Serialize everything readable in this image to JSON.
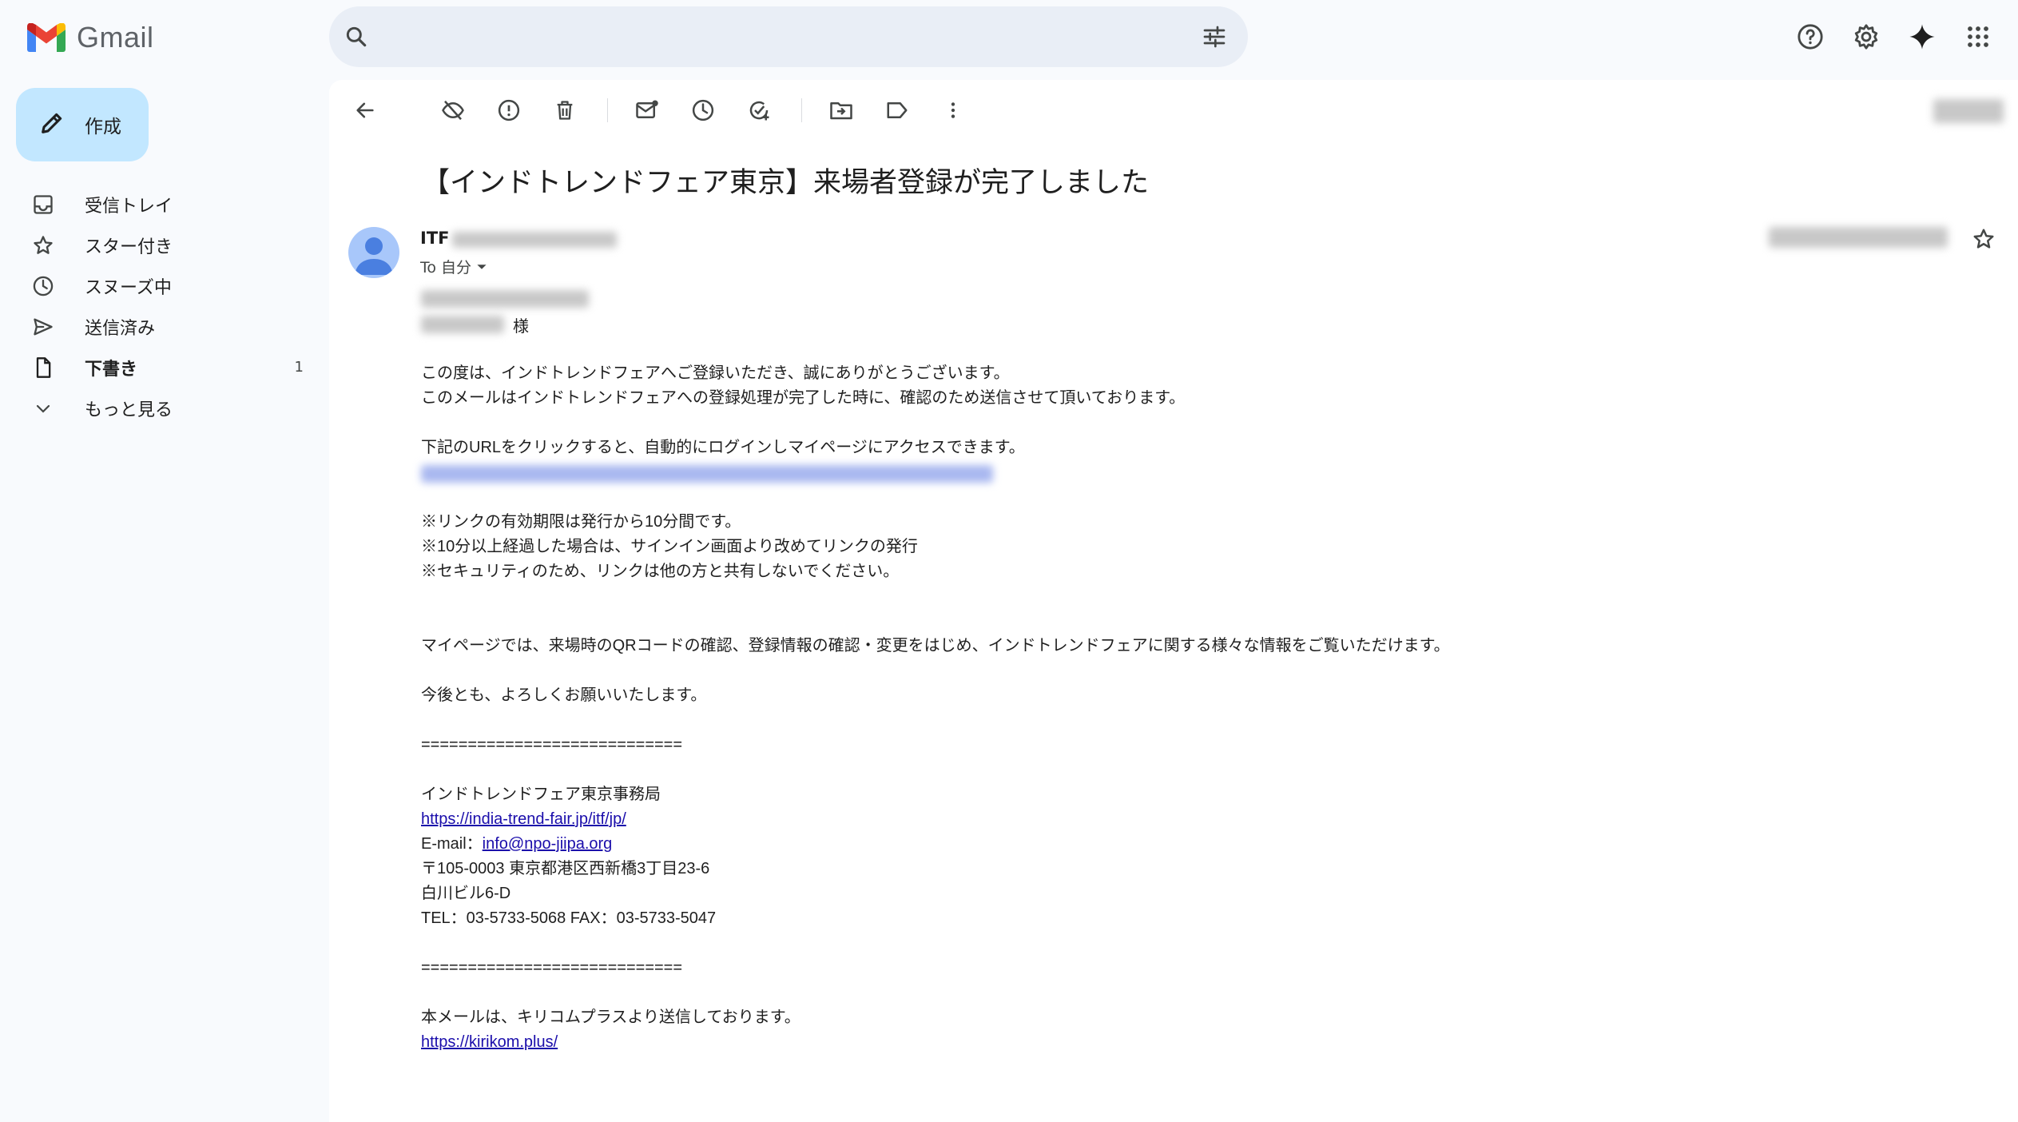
{
  "app": {
    "name": "Gmail"
  },
  "header": {
    "search_placeholder": ""
  },
  "compose": {
    "label": "作成"
  },
  "sidebar": {
    "items": [
      {
        "label": "受信トレイ",
        "icon": "inbox-icon"
      },
      {
        "label": "スター付き",
        "icon": "star-icon"
      },
      {
        "label": "スヌーズ中",
        "icon": "clock-icon"
      },
      {
        "label": "送信済み",
        "icon": "send-icon"
      },
      {
        "label": "下書き",
        "icon": "draft-icon",
        "count": "1",
        "bold": true
      },
      {
        "label": "もっと見る",
        "icon": "chevron-down-icon"
      }
    ]
  },
  "email": {
    "subject": "【インドトレンドフェア東京】来場者登録が完了しました",
    "sender_name": "ITF",
    "to_label": "To 自分",
    "salutation_suffix": "様",
    "body": {
      "p1": "この度は、インドトレンドフェアへご登録いただき、誠にありがとうございます。",
      "p2": "このメールはインドトレンドフェアへの登録処理が完了した時に、確認のため送信させて頂いております。",
      "p3": "下記のURLをクリックすると、自動的にログインしマイページにアクセスできます。",
      "n1": "※リンクの有効期限は発行から10分間です。",
      "n2": "※10分以上経過した場合は、サインイン画面より改めてリンクの発行",
      "n3": "※セキュリティのため、リンクは他の方と共有しないでください。",
      "p4": "マイページでは、来場時のQRコードの確認、登録情報の確認・変更をはじめ、インドトレンドフェアに関する様々な情報をご覧いただけます。",
      "p5": "今後とも、よろしくお願いいたします。",
      "sep": "============================",
      "org": "インドトレンドフェア東京事務局",
      "url1": "https://india-trend-fair.jp/itf/jp/",
      "email_label": "E-mail：",
      "email_addr": "info@npo-jiipa.org",
      "addr1": "〒105-0003 東京都港区西新橋3丁目23-6",
      "addr2": "白川ビル6-D",
      "tel": "TEL：03-5733-5068 FAX：03-5733-5047",
      "footer": "本メールは、キリコムプラスより送信しております。",
      "url2": "https://kirikom.plus/"
    }
  },
  "colors": {
    "accent": "#c2e7ff",
    "link": "#1a0dab",
    "background": "#f8fafd"
  }
}
